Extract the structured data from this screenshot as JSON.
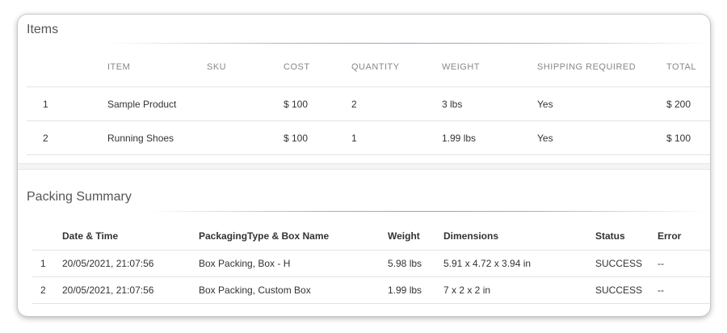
{
  "items_section": {
    "title": "Items",
    "columns": {
      "number": "",
      "item": "ITEM",
      "sku": "SKU",
      "cost": "COST",
      "quantity": "QUANTITY",
      "weight": "WEIGHT",
      "shipping_required": "SHIPPING REQUIRED",
      "total": "TOTAL"
    },
    "rows": [
      {
        "number": "1",
        "item": "Sample Product",
        "sku": "",
        "cost": "$ 100",
        "quantity": "2",
        "weight": "3 lbs",
        "shipping_required": "Yes",
        "total": "$ 200"
      },
      {
        "number": "2",
        "item": "Running Shoes",
        "sku": "",
        "cost": "$ 100",
        "quantity": "1",
        "weight": "1.99 lbs",
        "shipping_required": "Yes",
        "total": "$ 100"
      }
    ]
  },
  "packing_section": {
    "title": "Packing Summary",
    "columns": {
      "number": "",
      "date_time": "Date & Time",
      "box_name": "PackagingType & Box Name",
      "weight": "Weight",
      "dimensions": "Dimensions",
      "status": "Status",
      "error": "Error"
    },
    "rows": [
      {
        "number": "1",
        "date_time": "20/05/2021, 21:07:56",
        "box_name": "Box Packing, Box - H",
        "weight": "5.98 lbs",
        "dimensions": "5.91 x 4.72 x 3.94 in",
        "status": "SUCCESS",
        "error": "--"
      },
      {
        "number": "2",
        "date_time": "20/05/2021, 21:07:56",
        "box_name": "Box Packing, Custom Box",
        "weight": "1.99 lbs",
        "dimensions": "7 x 2 x 2 in",
        "status": "SUCCESS",
        "error": "--"
      }
    ]
  }
}
